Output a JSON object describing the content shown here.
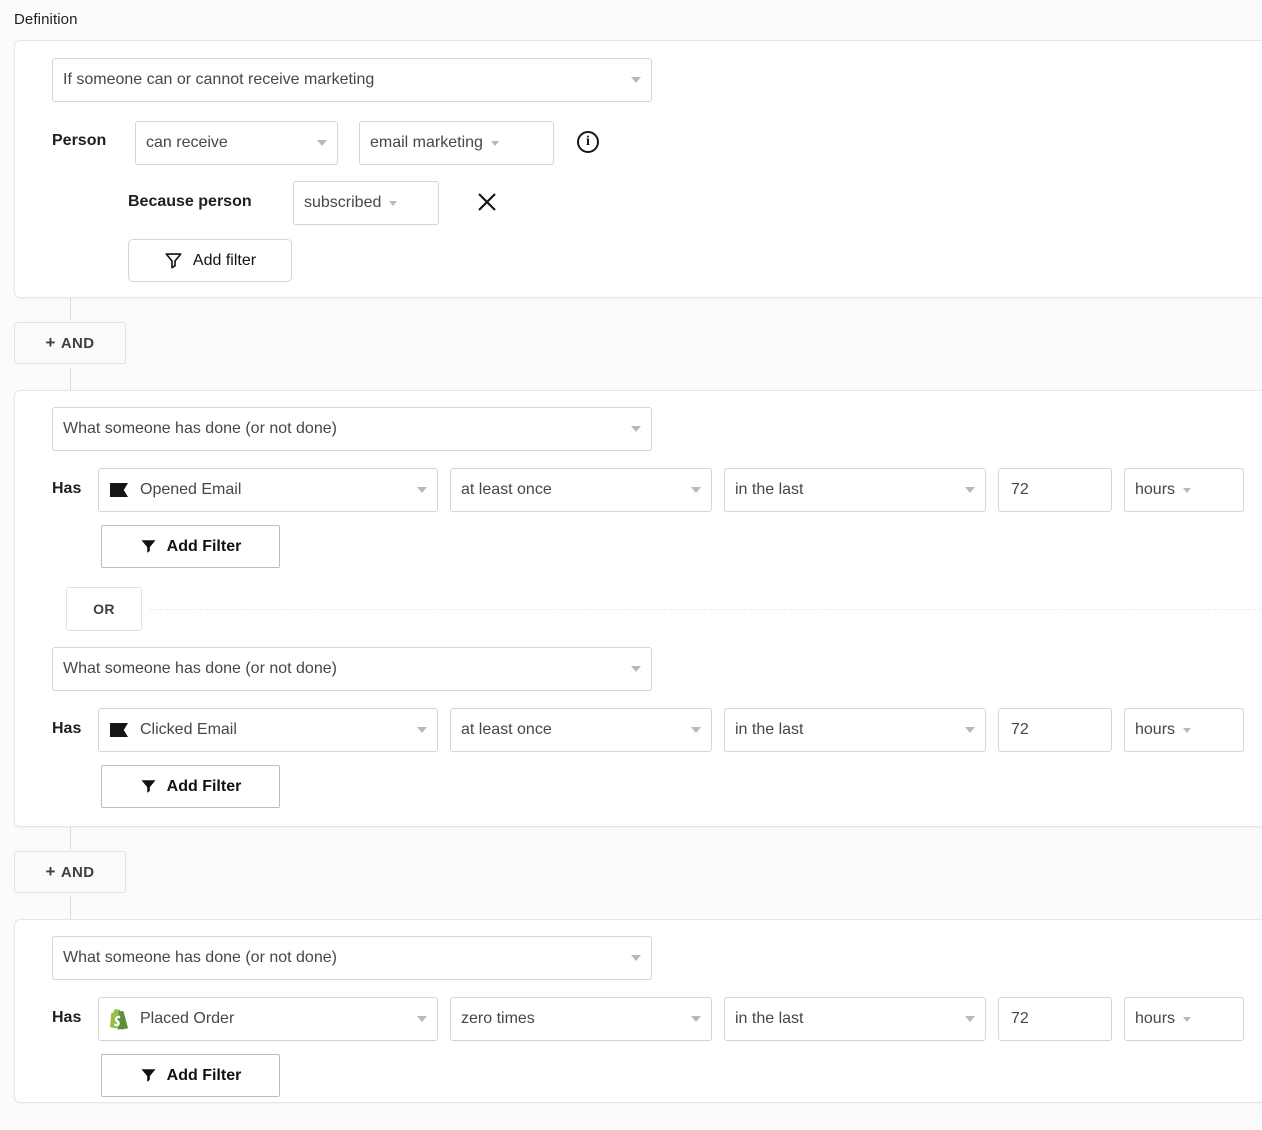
{
  "header": {
    "title": "Definition"
  },
  "operators": {
    "and_label": "AND",
    "plus": "+",
    "or_label": "OR"
  },
  "groups": [
    {
      "type_select": "If someone can or cannot receive marketing",
      "row_label": "Person",
      "consent": "can receive",
      "channel": "email marketing",
      "info_glyph": "i",
      "reason_label": "Because person",
      "reason_value": "subscribed",
      "add_filter_label": "Add filter"
    },
    {
      "type_select": "What someone has done (or not done)",
      "conditions": [
        {
          "row_label": "Has",
          "metric": "Opened Email",
          "metric_icon": "email-flag-icon",
          "frequency": "at least once",
          "timeframe": "in the last",
          "amount": "72",
          "unit": "hours",
          "add_filter_label": "Add Filter"
        },
        {
          "type_select": "What someone has done (or not done)",
          "row_label": "Has",
          "metric": "Clicked Email",
          "metric_icon": "email-flag-icon",
          "frequency": "at least once",
          "timeframe": "in the last",
          "amount": "72",
          "unit": "hours",
          "add_filter_label": "Add Filter"
        }
      ]
    },
    {
      "type_select": "What someone has done (or not done)",
      "row_label": "Has",
      "metric": "Placed Order",
      "metric_icon": "shopify-icon",
      "frequency": "zero times",
      "timeframe": "in the last",
      "amount": "72",
      "unit": "hours",
      "add_filter_label": "Add Filter"
    }
  ],
  "colors": {
    "page_bg": "#fbfbfb",
    "card_bg": "#ffffff",
    "border": "#d6d6d6",
    "text": "#474747",
    "shopify_green": "#95bf47",
    "shopify_green_dark": "#5e8e3e"
  }
}
